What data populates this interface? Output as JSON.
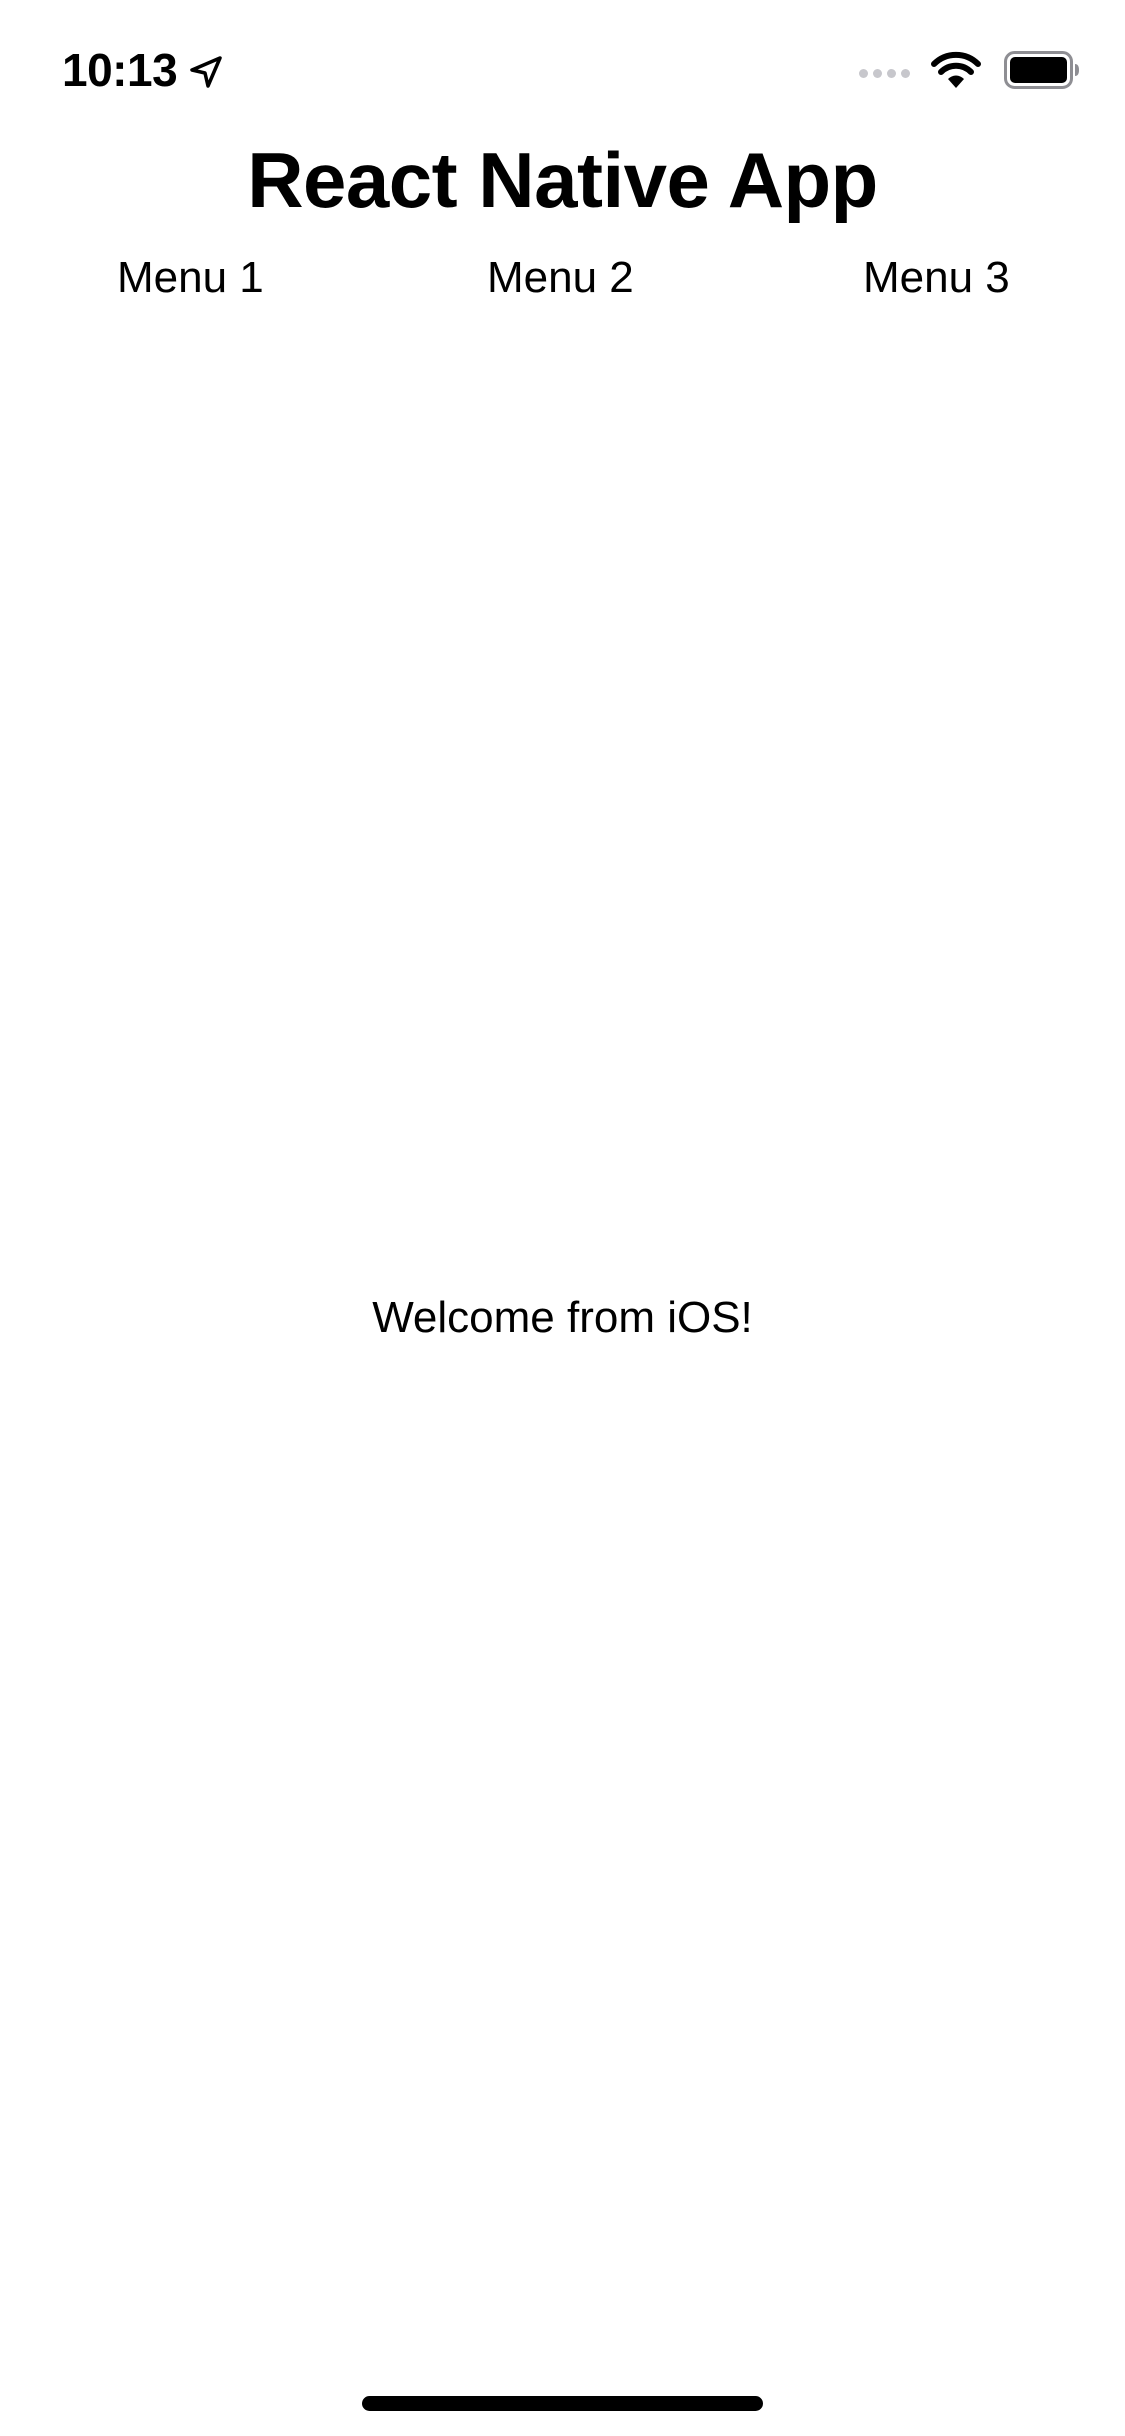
{
  "status_bar": {
    "time": "10:13",
    "location_icon": "location-arrow-icon",
    "signal_icon": "cellular-signal-icon",
    "wifi_icon": "wifi-icon",
    "battery_icon": "battery-full-icon"
  },
  "header": {
    "title": "React Native App"
  },
  "menu": {
    "items": [
      {
        "label": "Menu 1"
      },
      {
        "label": "Menu 2"
      },
      {
        "label": "Menu 3"
      }
    ]
  },
  "main": {
    "welcome_text": "Welcome from iOS!"
  },
  "colors": {
    "background": "#ffffff",
    "text": "#000000",
    "signal_inactive": "#c7c7cc"
  }
}
